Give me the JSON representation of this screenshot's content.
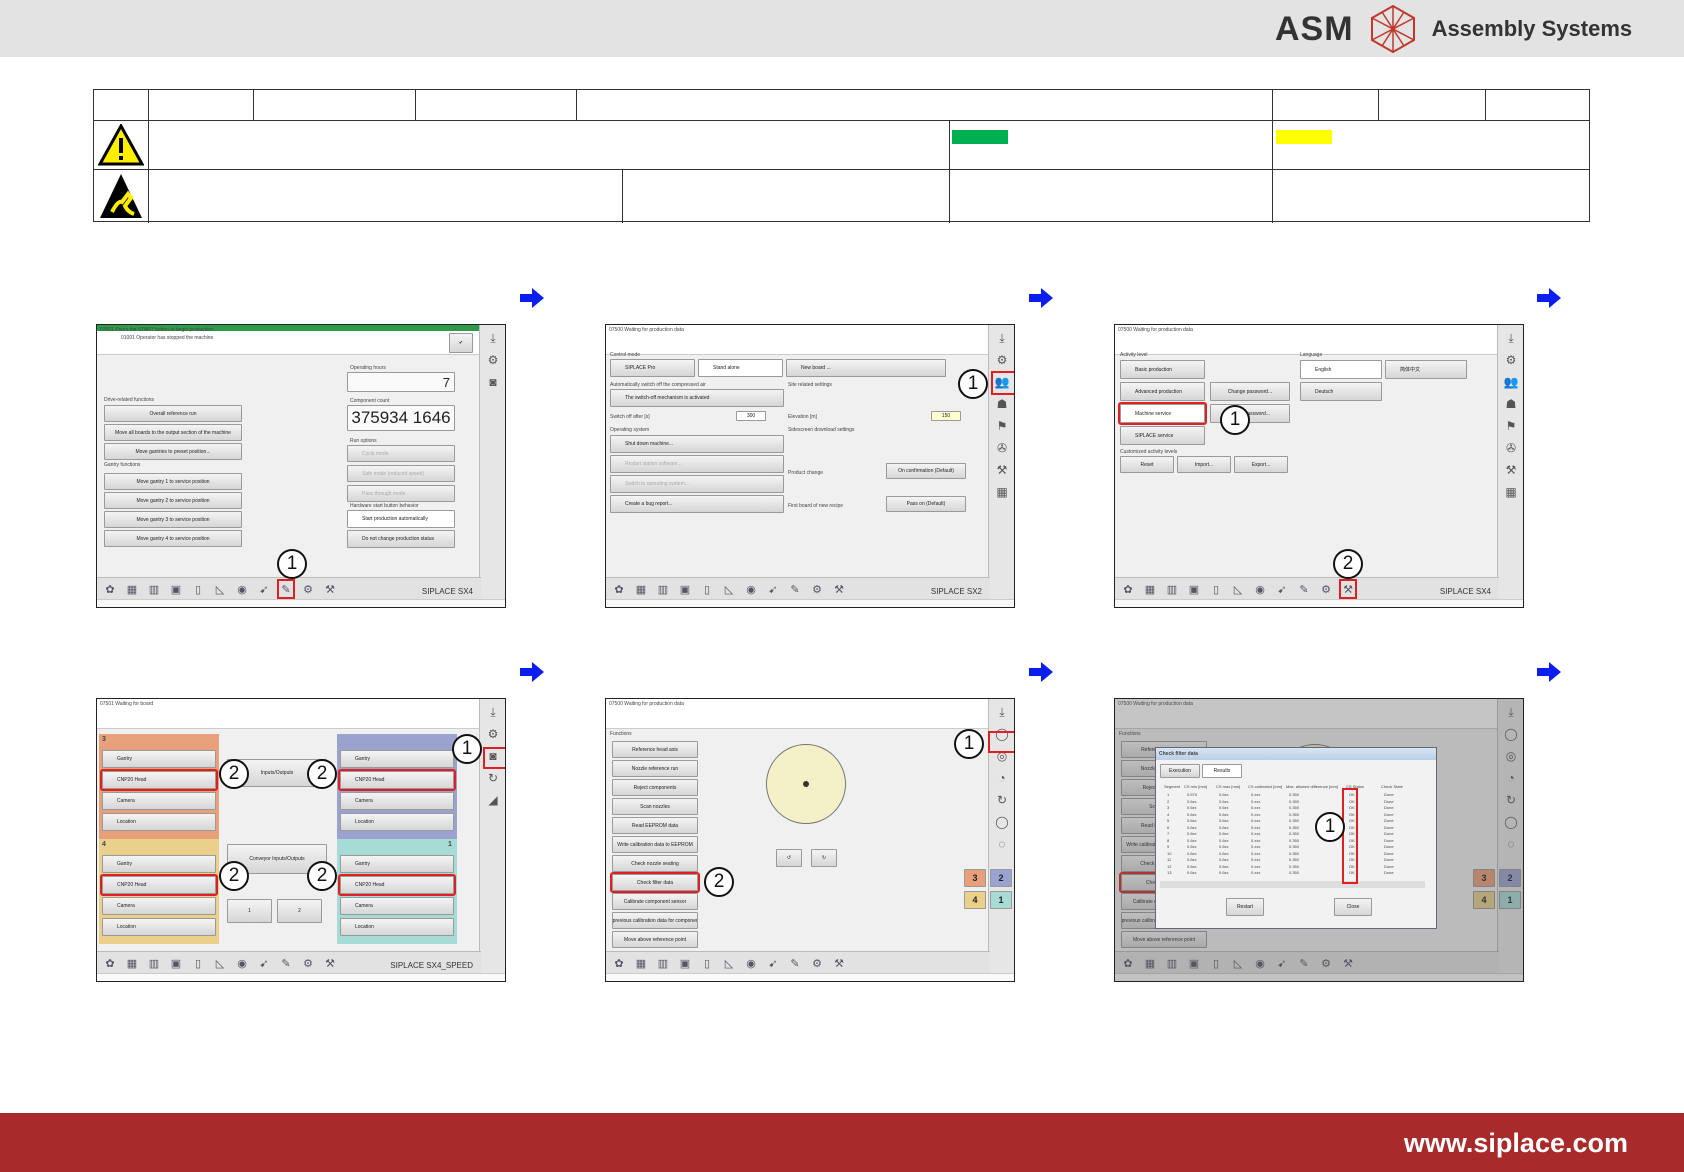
{
  "header": {
    "brand": "ASM",
    "subtitle": "Assembly Systems"
  },
  "legend_colors": {
    "green": "#00b050",
    "yellow": "#ffff00"
  },
  "footer": {
    "url": "www.siplace.com"
  },
  "panels": {
    "p1": {
      "title": "07001 Press the START button to begin production",
      "message": "01001 Operator has stopped the machine",
      "left_sections": [
        "Drive-related functions",
        "Gantry functions"
      ],
      "buttons": [
        "Overall reference run",
        "Move all boards to the output section of the machine",
        "Move gantries to preset position...",
        "Move gantry 1 to service position",
        "Move gantry 2 to service position",
        "Move gantry 3 to service position",
        "Move gantry 4 to service position"
      ],
      "operating_hours_label": "Operating hours",
      "operating_hours": "7",
      "component_count_label": "Component count",
      "component_count": "375934 1646",
      "run_options_label": "Run options",
      "run_options": [
        "Cycle mode",
        "Safe mode (reduced speed)",
        "Pass through mode"
      ],
      "hw_label": "Hardware start button behavior",
      "hw_options": [
        "Start production automatically",
        "Do not change production status"
      ],
      "model": "SIPLACE SX4",
      "callout": "1"
    },
    "p2": {
      "title": "07500 Waiting for production data",
      "control_label": "Control mode",
      "control": [
        "SIPLACE Pro",
        "Stand alone",
        "New board ..."
      ],
      "air_label": "Automatically switch off the compressed air",
      "air_check": "The switch-off mechanism is activated",
      "switch_off_label": "Switch off after [s]",
      "switch_off_value": "300",
      "site_label": "Site related settings",
      "elevation_label": "Elevation [m]",
      "elevation_value": "150",
      "os_label": "Operating system",
      "os_buttons": [
        "Shut down machine...",
        "Restart station software...",
        "Switch to operating system...",
        "Create a bug report..."
      ],
      "side_label": "Sidescreen download settings",
      "product_change_label": "Product change",
      "product_change": "On confirmation (Default)",
      "first_board_label": "First board of new recipe",
      "first_board": "Pass on (Default)",
      "model": "SIPLACE SX2",
      "callout": "1"
    },
    "p3": {
      "title": "07500 Waiting for production data",
      "activity_label": "Activity level",
      "activity": [
        "Basic production",
        "Advanced production",
        "Machine service",
        "SIPLACE service"
      ],
      "password": [
        "Change password...",
        "Reset password..."
      ],
      "custom_label": "Customized activity levels",
      "custom": [
        "Reset",
        "Import...",
        "Export..."
      ],
      "language_label": "Language",
      "languages": [
        "English",
        "简体中文",
        "Deutsch"
      ],
      "model": "SIPLACE SX4",
      "callouts": [
        "1",
        "2"
      ]
    },
    "p4": {
      "title": "07501 Waiting for board",
      "segments": [
        "3",
        "",
        "4",
        "1"
      ],
      "seg_buttons": [
        "Gantry",
        "CNP20 Head",
        "Camera",
        "Location"
      ],
      "io": "Inputs/Outputs",
      "conveyor_io": "Conveyor Inputs/Outputs",
      "small": [
        "1",
        "2"
      ],
      "model": "SIPLACE SX4_SPEED",
      "callouts": [
        "1",
        "2"
      ]
    },
    "p5": {
      "title": "07500 Waiting for production data",
      "functions_label": "Functions",
      "functions": [
        "Reference head axis",
        "Nozzle reference run",
        "Reject components",
        "Scan nozzles",
        "Read EEPROM data",
        "Write calibration data to EEPROM",
        "Check nozzle seating",
        "Check filter data",
        "Calibrate component sensor",
        "Activate previous calibration data for component sensor",
        "Move above reference point"
      ],
      "segments": [
        "3",
        "2",
        "4",
        "1"
      ],
      "callouts": [
        "1",
        "2"
      ]
    },
    "p6": {
      "dialog_title": "Check filter data",
      "tabs": [
        "Execution",
        "Results"
      ],
      "columns": [
        "Segment",
        "CS min [mm]",
        "CS max [mm]",
        "CS calibrated [mm]",
        "Max. allowed difference [mm]",
        "CS Status",
        "Check State"
      ],
      "rows": [
        [
          "1",
          "0.570",
          "0.6xx",
          "0.xxx",
          "0.350",
          "OK",
          "Done"
        ],
        [
          "2",
          "0.6xx",
          "0.6xx",
          "0.xxx",
          "0.350",
          "OK",
          "Done"
        ],
        [
          "3",
          "0.6xx",
          "0.6xx",
          "0.xxx",
          "0.350",
          "OK",
          "Done"
        ],
        [
          "4",
          "0.6xx",
          "0.6xx",
          "0.xxx",
          "0.350",
          "OK",
          "Done"
        ],
        [
          "5",
          "0.6xx",
          "0.6xx",
          "0.xxx",
          "0.350",
          "OK",
          "Done"
        ],
        [
          "6",
          "0.6xx",
          "0.6xx",
          "0.xxx",
          "0.350",
          "OK",
          "Done"
        ],
        [
          "7",
          "0.6xx",
          "0.6xx",
          "0.xxx",
          "0.350",
          "OK",
          "Done"
        ],
        [
          "8",
          "0.6xx",
          "0.6xx",
          "0.xxx",
          "0.350",
          "OK",
          "Done"
        ],
        [
          "9",
          "0.6xx",
          "0.6xx",
          "0.xxx",
          "0.350",
          "OK",
          "Done"
        ],
        [
          "10",
          "0.6xx",
          "0.6xx",
          "0.xxx",
          "0.350",
          "OK",
          "Done"
        ],
        [
          "11",
          "0.6xx",
          "0.6xx",
          "0.xxx",
          "0.350",
          "OK",
          "Done"
        ],
        [
          "12",
          "0.6xx",
          "0.6xx",
          "0.xxx",
          "0.350",
          "OK",
          "Done"
        ],
        [
          "13",
          "0.6xx",
          "0.6xx",
          "0.xxx",
          "0.350",
          "OK",
          "Done"
        ]
      ],
      "buttons": [
        "Restart",
        "Close"
      ],
      "callout": "1"
    }
  }
}
